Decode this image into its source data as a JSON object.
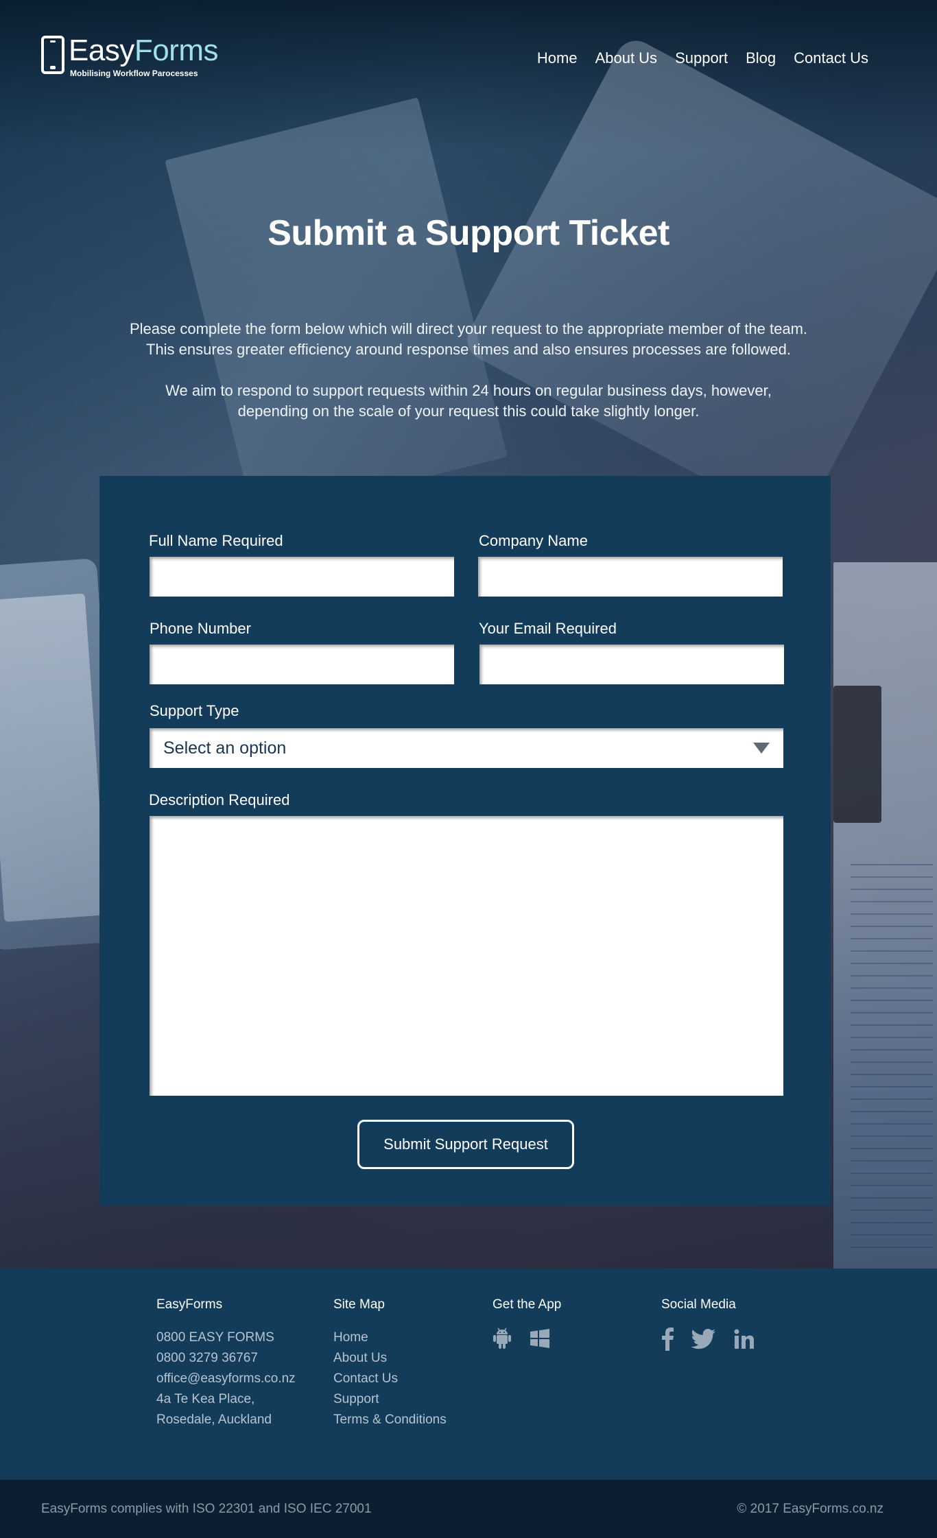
{
  "header": {
    "logo_easy": "Easy",
    "logo_forms": "Forms",
    "logo_tagline": "Mobilising Workflow Parocesses",
    "nav": [
      "Home",
      "About Us",
      "Support",
      "Blog",
      "Contact Us"
    ]
  },
  "hero": {
    "title": "Submit a Support Ticket",
    "intro_1_line_1": "Please complete the form below which will direct your request to the appropriate member of the team.",
    "intro_1_line_2": "This ensures greater efficiency around response times and also ensures processes are followed.",
    "intro_2_line_1": "We aim to respond to support requests within 24 hours on regular business days, however,",
    "intro_2_line_2": "depending on the scale of your request this could take slightly longer."
  },
  "form": {
    "full_name_label": "Full Name Required",
    "full_name_value": "",
    "company_label": "Company Name",
    "company_value": "",
    "phone_label": "Phone Number",
    "phone_value": "",
    "email_label": "Your Email Required",
    "email_value": "",
    "support_type_label": "Support Type",
    "support_type_selected": "Select an option",
    "description_label": "Description Required",
    "description_value": "",
    "submit_label": "Submit Support Request"
  },
  "footer": {
    "col1_title": "EasyForms",
    "col1_items": [
      "0800 EASY FORMS",
      "0800 3279 36767",
      "office@easyforms.co.nz",
      "4a Te Kea Place,",
      "Rosedale, Auckland"
    ],
    "col2_title": "Site Map",
    "col2_items": [
      "Home",
      "About Us",
      "Contact Us",
      "Support",
      "Terms & Conditions"
    ],
    "col3_title": "Get the App",
    "col3_icons": [
      "android-icon",
      "windows-icon"
    ],
    "col4_title": "Social Media",
    "col4_icons": [
      "facebook-icon",
      "twitter-icon",
      "linkedin-icon"
    ],
    "compliance": "EasyForms complies with ISO 22301 and ISO IEC 27001",
    "copyright": "© 2017 EasyForms.co.nz"
  },
  "colors": {
    "panel": "#133b5a",
    "footer": "#133b5a",
    "bottom_bar": "#0b1f31",
    "logo_accent": "#9fe0ea"
  }
}
